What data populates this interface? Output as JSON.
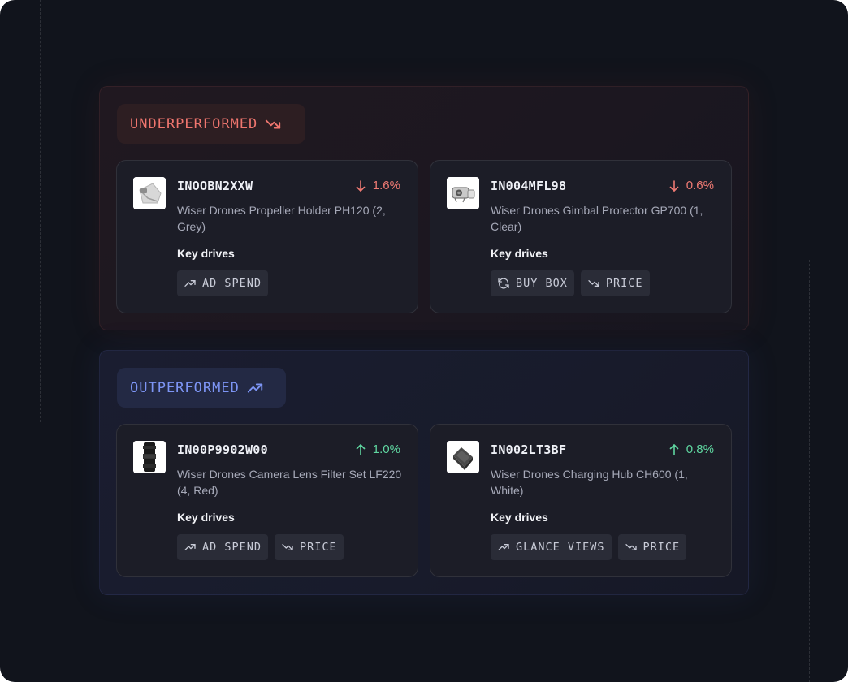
{
  "colors": {
    "background": "#11141c",
    "under_accent": "#f0766f",
    "over_accent": "#7d95f5",
    "down": "#ef7a73",
    "up": "#5fd6a0"
  },
  "sections": [
    {
      "label": "UNDERPERFORMED",
      "trend_icon": "trending-down-icon",
      "cards": [
        {
          "asin": "INOOBN2XXW",
          "delta_direction": "down",
          "delta": "1.6%",
          "description": "Wiser Drones Propeller Holder PH120 (2, Grey)",
          "key_drives_label": "Key drives",
          "tags": [
            {
              "label": "AD SPEND",
              "icon": "trending-up-icon"
            }
          ]
        },
        {
          "asin": "IN004MFL98",
          "delta_direction": "down",
          "delta": "0.6%",
          "description": "Wiser Drones Gimbal Protector GP700 (1, Clear)",
          "key_drives_label": "Key drives",
          "tags": [
            {
              "label": "BUY BOX",
              "icon": "refresh-icon"
            },
            {
              "label": "PRICE",
              "icon": "trending-down-icon"
            }
          ]
        }
      ]
    },
    {
      "label": "OUTPERFORMED",
      "trend_icon": "trending-up-icon",
      "cards": [
        {
          "asin": "IN00P9902W00",
          "delta_direction": "up",
          "delta": "1.0%",
          "description": "Wiser Drones Camera Lens Filter Set LF220 (4, Red)",
          "key_drives_label": "Key drives",
          "tags": [
            {
              "label": "AD SPEND",
              "icon": "trending-up-icon"
            },
            {
              "label": "PRICE",
              "icon": "trending-down-icon"
            }
          ]
        },
        {
          "asin": "IN002LT3BF",
          "delta_direction": "up",
          "delta": "0.8%",
          "description": "Wiser Drones Charging Hub CH600 (1, White)",
          "key_drives_label": "Key drives",
          "tags": [
            {
              "label": "GLANCE VIEWS",
              "icon": "trending-up-icon"
            },
            {
              "label": "PRICE",
              "icon": "trending-down-icon"
            }
          ]
        }
      ]
    }
  ]
}
